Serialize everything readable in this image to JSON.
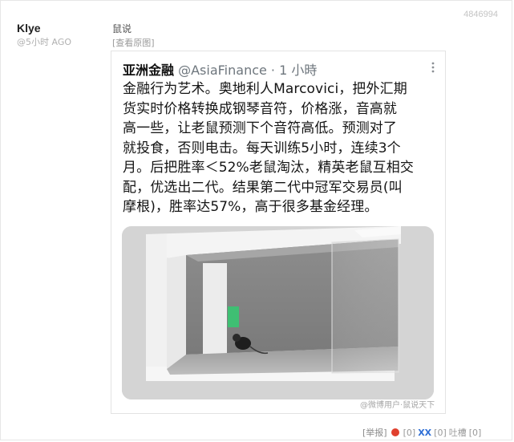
{
  "post": {
    "author": "Klye",
    "time": "@5小时 AGO",
    "title": "鼠说",
    "view_original": "[查看原图]",
    "id": "4846994"
  },
  "tweet": {
    "account_name": "亚洲金融",
    "handle_time": " @AsiaFinance · 1 小時",
    "body": "金融行为艺术。奥地利人Marcovici，把外汇期\n货实时价格转换成钢琴音符，价格涨，音高就\n高一些，让老鼠预测下个音符高低。预测对了\n就投食，否则电击。每天训练5小时，连续3个\n月。后把胜率＜52%老鼠淘汰，精英老鼠互相交\n配，优选出二代。结果第二代中冠军交易员(叫\n摩根)，胜率达57%，高于很多基金经理。",
    "watermark": "@微博用户·鼠说天下"
  },
  "actions": {
    "report": "[举报]",
    "oo_count": "[0]",
    "xx_label": "XX",
    "xx_count": "[0]",
    "tucao": "吐槽",
    "tucao_count": "[0]"
  },
  "colors": {
    "accent_blue": "#2f6fd6",
    "accent_red": "#e0402e"
  }
}
